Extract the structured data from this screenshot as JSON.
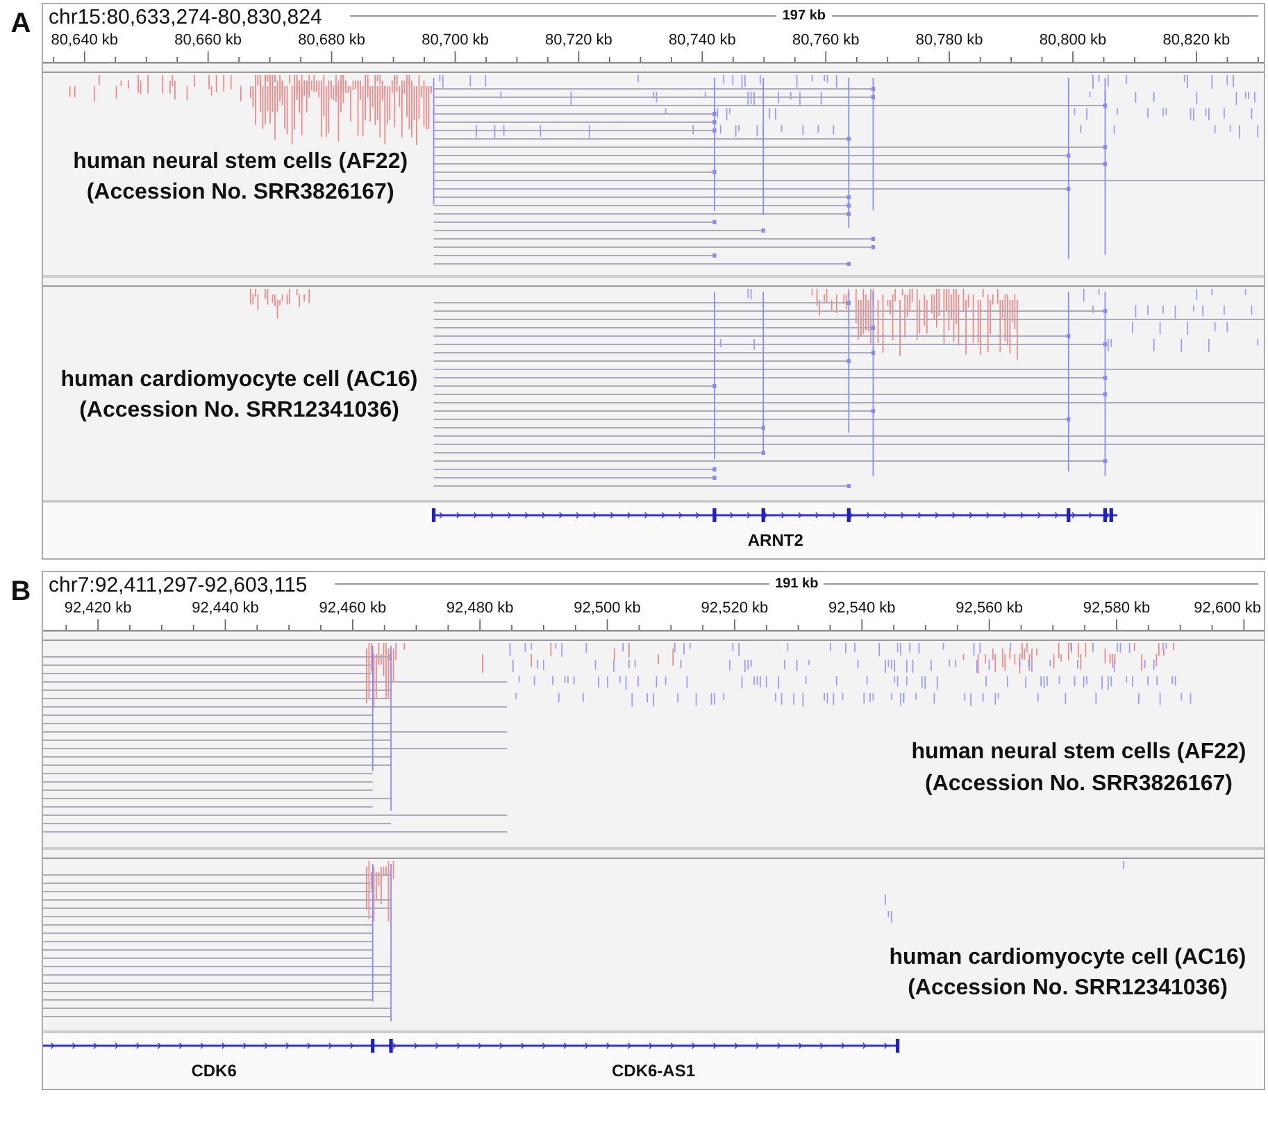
{
  "panels": [
    {
      "letter": "A",
      "locus": "chr15:80,633,274-80,830,824",
      "span": "197 kb",
      "ticks": [
        "80,640 kb",
        "80,660 kb",
        "80,680 kb",
        "80,700 kb",
        "80,720 kb",
        "80,740 kb",
        "80,760 kb",
        "80,780 kb",
        "80,800 kb",
        "80,820 kb"
      ],
      "tracks": [
        {
          "label_lines": [
            "human neural stem cells (AF22)",
            "(Accession No. SRR3826167)"
          ]
        },
        {
          "label_lines": [
            "human cardiomyocyte cell (AC16)",
            "(Accession No. SRR12341036)"
          ]
        }
      ],
      "genes": [
        "ARNT2"
      ]
    },
    {
      "letter": "B",
      "locus": "chr7:92,411,297-92,603,115",
      "span": "191 kb",
      "ticks": [
        "92,420 kb",
        "92,440 kb",
        "92,460 kb",
        "92,480 kb",
        "92,500 kb",
        "92,520 kb",
        "92,540 kb",
        "92,560 kb",
        "92,580 kb",
        "92,600 kb"
      ],
      "tracks": [
        {
          "label_lines": [
            "human neural stem cells (AF22)",
            "(Accession No. SRR3826167)"
          ]
        },
        {
          "label_lines": [
            "human cardiomyocyte cell (AC16)",
            "(Accession No. SRR12341036)"
          ]
        }
      ],
      "genes": [
        "CDK6",
        "CDK6-AS1"
      ]
    }
  ]
}
